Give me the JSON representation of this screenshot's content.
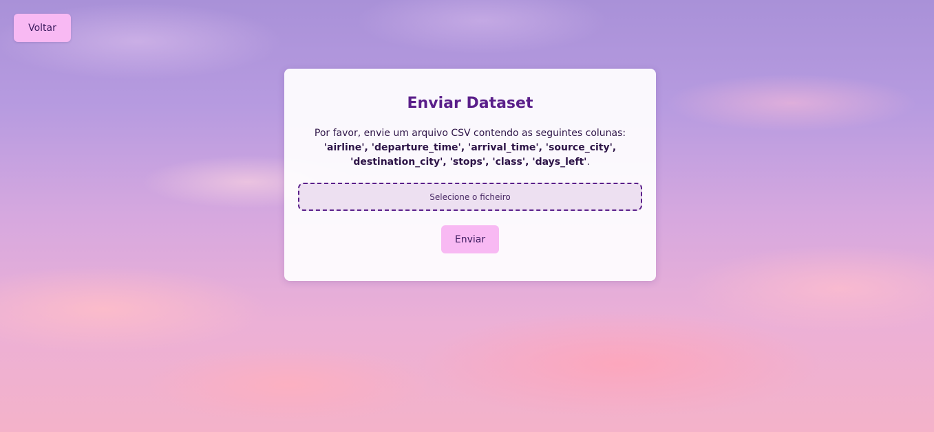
{
  "nav": {
    "back_label": "Voltar"
  },
  "upload": {
    "title": "Enviar Dataset",
    "description_prefix": "Por favor, envie um arquivo CSV contendo as seguintes colunas:",
    "columns_text": "'airline', 'departure_time', 'arrival_time', 'source_city', 'destination_city', 'stops', 'class', 'days_left'",
    "description_suffix": ".",
    "file_input_label": "Selecione o ficheiro",
    "submit_label": "Enviar"
  },
  "colors": {
    "button_bg": "#f8b9f3",
    "title": "#5a1f8a",
    "dropzone_border": "#5a1f8a",
    "dropzone_bg": "#ede0f1"
  }
}
